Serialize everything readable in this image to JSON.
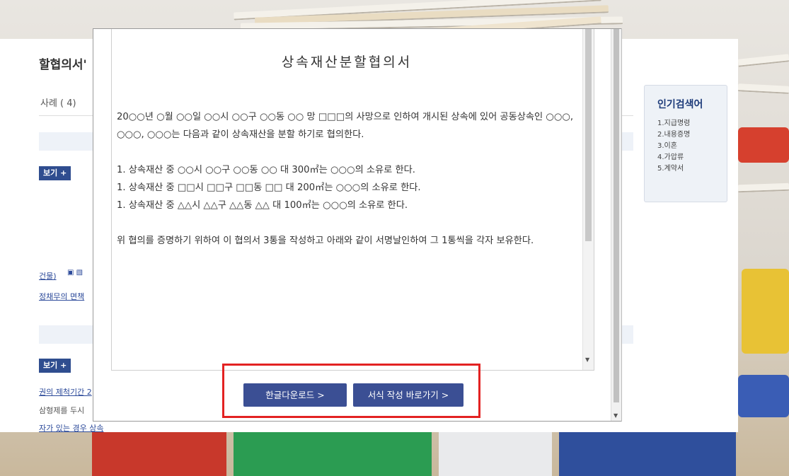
{
  "background": {
    "title_fragment": "할협의서'",
    "case_fragment": "사례 ( 4)",
    "more_button_1": "보기 +",
    "more_button_2": "보기 +",
    "link_fragment_1": "건물)",
    "link_fragment_2": "정채무의 면책",
    "link_fragment_3": "권의 제척기간 2",
    "grey_fragment_1": "삼형제를 두시",
    "grey_fragment_2": "자가 있는 경우 상속"
  },
  "popular": {
    "heading": "인기검색어",
    "items": [
      "1.지급명령",
      "2.내용증명",
      "3.이혼",
      "4.가압류",
      "5.계약서"
    ]
  },
  "modal": {
    "doc_title": "상속재산분할협의서",
    "paragraph_1": "20○○년 ○월 ○○일 ○○시 ○○구 ○○동 ○○ 망 □□□의 사망으로 인하여 개시된 상속에 있어 공동상속인 ○○○, ○○○, ○○○는 다음과 같이 상속재산을 분할 하기로 협의한다.",
    "items": [
      "1. 상속재산 중 ○○시 ○○구 ○○동 ○○ 대 300㎡는 ○○○의 소유로 한다.",
      "1. 상속재산 중 □□시 □□구 □□동 □□ 대 200㎡는 ○○○의 소유로 한다.",
      "1. 상속재산 중 △△시 △△구 △△동 △△ 대 100㎡는 ○○○의 소유로 한다."
    ],
    "paragraph_2": "위 협의를 증명하기 위하여 이 협의서 3통을 작성하고 아래와 같이 서명날인하여 그 1통씩을 각자 보유한다.",
    "buttons": {
      "hwp_download": "한글다운로드 >",
      "form_shortcut": "서식 작성 바로가기 >"
    },
    "highlight_color": "#e32222",
    "button_color": "#3b4f94"
  }
}
